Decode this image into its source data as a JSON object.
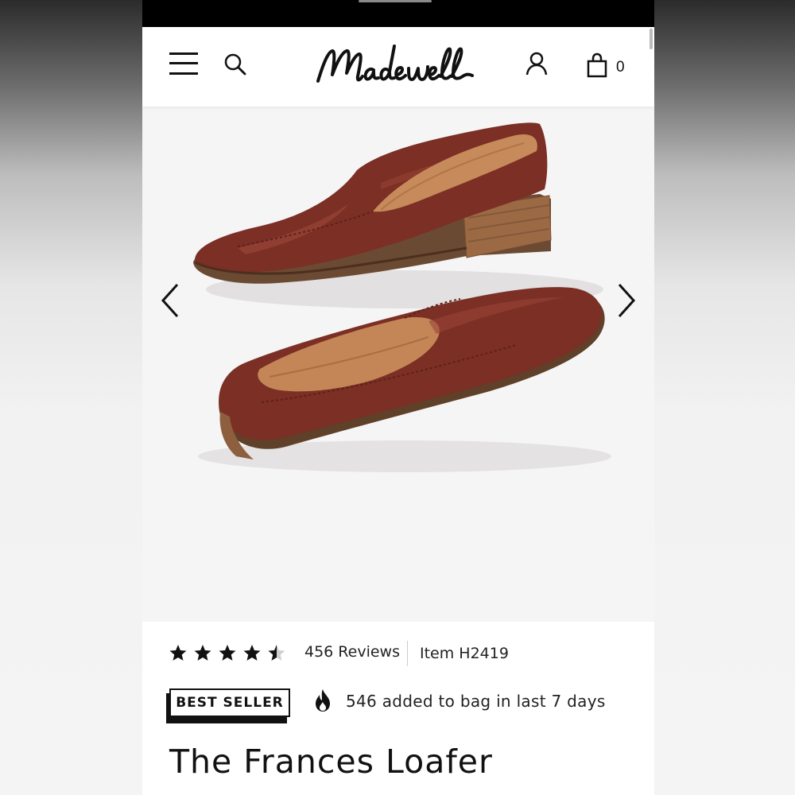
{
  "header": {
    "brand": "Madewell",
    "bag_count": "0",
    "icons": [
      "menu-icon",
      "search-icon",
      "account-icon",
      "bag-icon"
    ]
  },
  "gallery": {
    "icons": [
      "chevron-left-icon",
      "chevron-right-icon"
    ]
  },
  "product": {
    "rating_out_of_5": 4.5,
    "reviews_label": "456 Reviews",
    "item_number": "Item H2419",
    "badge": "BEST SELLER",
    "added_to_bag": "546 added to bag in last 7 days",
    "title": "The Frances Loafer"
  },
  "colors": {
    "accent": "#111111",
    "leather": "#7a2e24",
    "sole": "#8a5a3a",
    "background": "#ffffff"
  }
}
